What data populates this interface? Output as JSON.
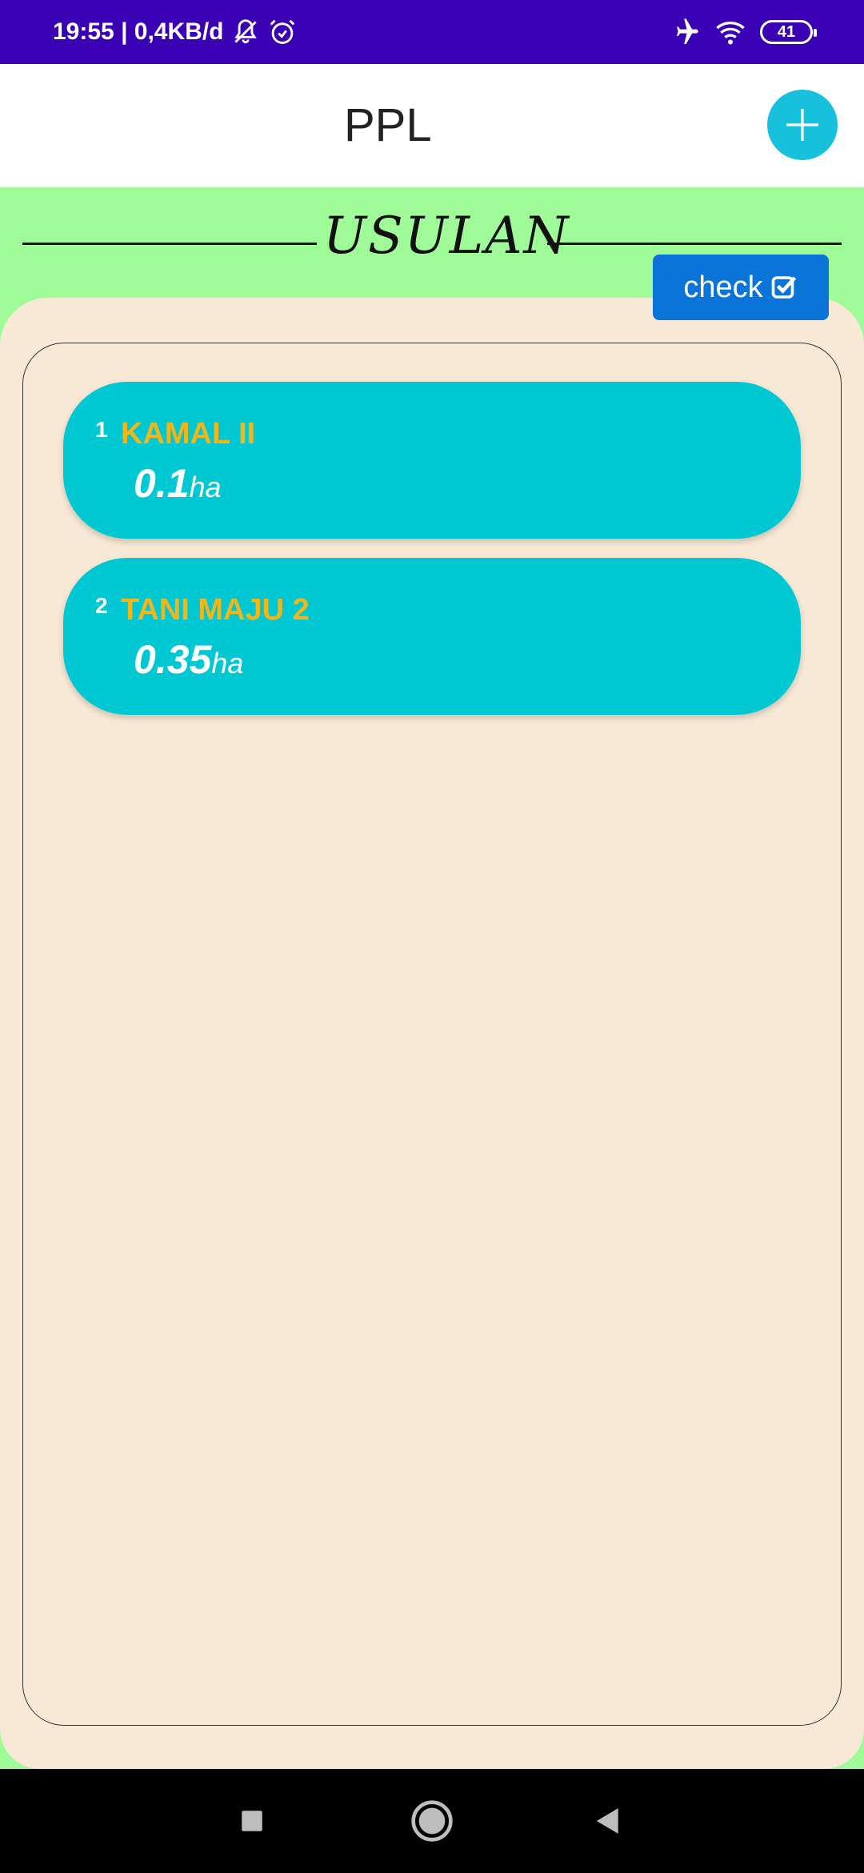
{
  "status_bar": {
    "time_text": "19:55 | 0,4KB/d",
    "battery": "41",
    "icons": [
      "bell-off-icon",
      "alarm-icon",
      "airplane-icon",
      "wifi-icon",
      "battery-icon"
    ]
  },
  "app_bar": {
    "title": "PPL",
    "add_icon": "plus-icon"
  },
  "section": {
    "title": "USULAN"
  },
  "check_button": {
    "label": "check",
    "icon": "checkbox-checked-icon"
  },
  "items": [
    {
      "number": "1",
      "name": "KAMAL II",
      "area": "0.1",
      "unit": "ha"
    },
    {
      "number": "2",
      "name": "TANI MAJU 2",
      "area": "0.35",
      "unit": "ha"
    }
  ],
  "nav_bar": {
    "icons": [
      "recents-square-icon",
      "home-circle-icon",
      "back-triangle-icon"
    ]
  },
  "colors": {
    "status_bar": "#3a00b4",
    "background": "#9ffb98",
    "panel": "#f7e9d6",
    "card": "#00c8d3",
    "card_name": "#f2b619",
    "check_button": "#0a74d8",
    "add_button": "#17c1dc"
  }
}
